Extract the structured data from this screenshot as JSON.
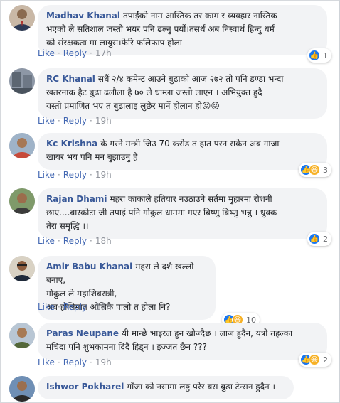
{
  "comments": [
    {
      "author": "Madhav Khanal",
      "text": "तपाईंको नाम आस्तिक तर काम र व्यवहार नास्तिक\nभएको ले सतिशाल जस्तो भयर पनि ढल्नु पर्यो।तसर्थ अब निस्वार्थ हिन्दु धर्म\nको संरक्षकत्व मा लायुस।फेरि फलिफाप होला",
      "like": "Like",
      "reply": "Reply",
      "time": "17h",
      "reactions": [
        "like"
      ],
      "reaction_count": "1"
    },
    {
      "author": "RC Khanal",
      "text": "सधैं २/४ कमेन्ट आउने बुढाको आज २७२ तो पनि डण्डा भन्दा\nखतरनाक हैट बुढा ढलौला है ७० ले धाम्ला जस्तो लाएन । अभियुक्त हुदै\nयस्तो प्रमाणित भए त बुढालाइ लुछेर मार्ने होलान हो😝😝",
      "like": "Like",
      "reply": "Reply",
      "time": "19h",
      "reactions": [],
      "reaction_count": ""
    },
    {
      "author": "Kc Krishna",
      "text": "के गरने मन्त्री जिउ 70 करोड त हात परन सकेन अब गाजा\nखायर भय पनि मन बुझाउनु हे",
      "like": "Like",
      "reply": "Reply",
      "time": "19h",
      "reactions": [
        "like",
        "haha"
      ],
      "reaction_count": "3"
    },
    {
      "author": "Rajan Dhami",
      "text": "महरा काकाले हतियार नउठाउने सर्तमा मुहारमा रोशनी\nछाए....बास्कोटा जी तपाई पनि गोकुल धाममा गएर बिष्णु बिष्णु भन्नु । धुक्क\nतेरा समृद्धि ।।",
      "like": "Like",
      "reply": "Reply",
      "time": "18h",
      "reactions": [
        "like"
      ],
      "reaction_count": "2"
    },
    {
      "author": "Amir Babu Khanal",
      "text": "महरा ले दशै खल्लो बनाए,\nगोकुल ले महाशिबरात्री,\nअब होलिमात ओलिकै पालो त होला नि?",
      "like": "Like",
      "reply": "Reply",
      "time": "19h",
      "reactions": [
        "like",
        "haha"
      ],
      "reaction_count": "10"
    },
    {
      "author": "Paras Neupane",
      "text": "यी मान्छे भाइरल हुन खोज्दैछ । लाज हुदैन, यत्रो तहल्का\nमचिदा पनि शुभकामना दिदै हिड्न । इज्जत छैन ???",
      "like": "Like",
      "reply": "Reply",
      "time": "19h",
      "reactions": [
        "like",
        "haha"
      ],
      "reaction_count": "2"
    },
    {
      "author": "Ishwor Pokharel",
      "text": "गाँजा को नसामा लठ्ठ परेर बस बुढा टेन्सन हुदैन ।",
      "like": "",
      "reply": "",
      "time": "",
      "reactions": [],
      "reaction_count": ""
    }
  ],
  "colors": {
    "author": "#385898",
    "bubble": "#f2f3f5",
    "link": "#4267b2",
    "like_reaction": "#1877f2",
    "haha_reaction": "#f7b125"
  }
}
